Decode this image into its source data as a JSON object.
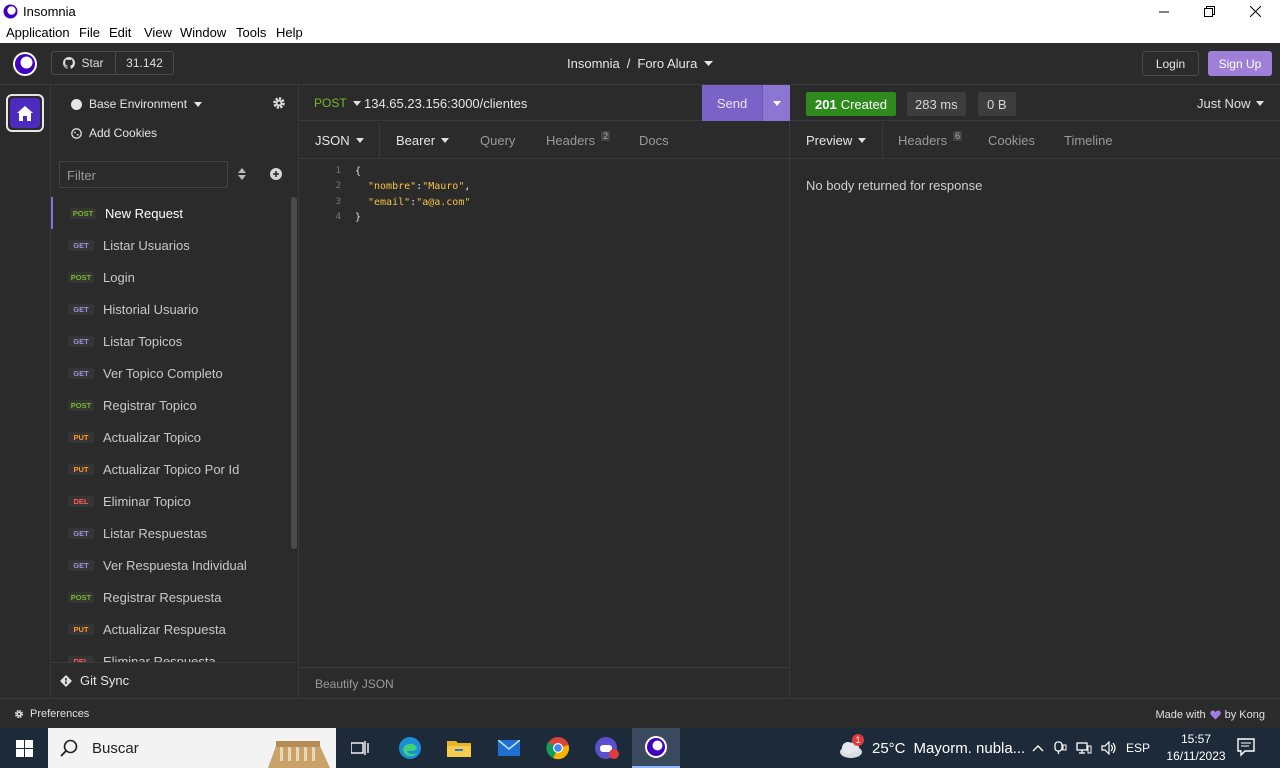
{
  "window": {
    "title": "Insomnia"
  },
  "menubar": [
    "Application",
    "File",
    "Edit",
    "View",
    "Window",
    "Tools",
    "Help"
  ],
  "header": {
    "github_star_label": "Star",
    "github_star_count": "31.142",
    "project": "Insomnia",
    "separator": "/",
    "collection": "Foro Alura",
    "login_label": "Login",
    "signup_label": "Sign Up"
  },
  "sidebar": {
    "environment": "Base Environment",
    "add_cookies": "Add Cookies",
    "filter_placeholder": "Filter",
    "requests": [
      {
        "method": "POST",
        "name": "New Request",
        "active": true
      },
      {
        "method": "GET",
        "name": "Listar Usuarios"
      },
      {
        "method": "POST",
        "name": "Login"
      },
      {
        "method": "GET",
        "name": "Historial Usuario"
      },
      {
        "method": "GET",
        "name": "Listar Topicos"
      },
      {
        "method": "GET",
        "name": "Ver Topico Completo"
      },
      {
        "method": "POST",
        "name": "Registrar Topico"
      },
      {
        "method": "PUT",
        "name": "Actualizar Topico"
      },
      {
        "method": "PUT",
        "name": "Actualizar Topico Por Id"
      },
      {
        "method": "DEL",
        "name": "Eliminar Topico"
      },
      {
        "method": "GET",
        "name": "Listar Respuestas"
      },
      {
        "method": "GET",
        "name": "Ver Respuesta Individual"
      },
      {
        "method": "POST",
        "name": "Registrar Respuesta"
      },
      {
        "method": "PUT",
        "name": "Actualizar Respuesta"
      },
      {
        "method": "DEL",
        "name": "Eliminar Respuesta"
      }
    ],
    "git_sync": "Git Sync"
  },
  "request": {
    "method": "POST",
    "url": "134.65.23.156:3000/clientes",
    "send_label": "Send",
    "tabs": {
      "body": "JSON",
      "auth": "Bearer",
      "query": "Query",
      "headers": "Headers",
      "headers_count": "2",
      "docs": "Docs"
    },
    "body_lines": [
      {
        "num": "1",
        "text": "{"
      },
      {
        "num": "2",
        "key": "\"nombre\"",
        "sep": ":",
        "val": "\"Mauro\"",
        "trail": ","
      },
      {
        "num": "3",
        "key": "\"email\"",
        "sep": ":",
        "val": "\"a@a.com\"",
        "trail": ""
      },
      {
        "num": "4",
        "text": "}"
      }
    ],
    "beautify_label": "Beautify JSON"
  },
  "response": {
    "status_code": "201",
    "status_text": "Created",
    "time": "283 ms",
    "size": "0 B",
    "history": "Just Now",
    "tabs": {
      "preview": "Preview",
      "headers": "Headers",
      "headers_count": "6",
      "cookies": "Cookies",
      "timeline": "Timeline"
    },
    "empty_message": "No body returned for response"
  },
  "footer": {
    "preferences": "Preferences",
    "made_with": "Made with",
    "by": "by Kong"
  },
  "taskbar": {
    "search_placeholder": "Buscar",
    "weather_temp": "25°C",
    "weather_desc": "Mayorm. nubla...",
    "weather_badge": "1",
    "language": "ESP",
    "time": "15:57",
    "date": "16/11/2023"
  },
  "colors": {
    "accent": "#7a63c6",
    "status_ok": "#2f8a1e",
    "method_post": "#75ba24",
    "method_get": "#a08ee0",
    "method_put": "#ff9a1f",
    "method_del": "#ff5a5a"
  }
}
